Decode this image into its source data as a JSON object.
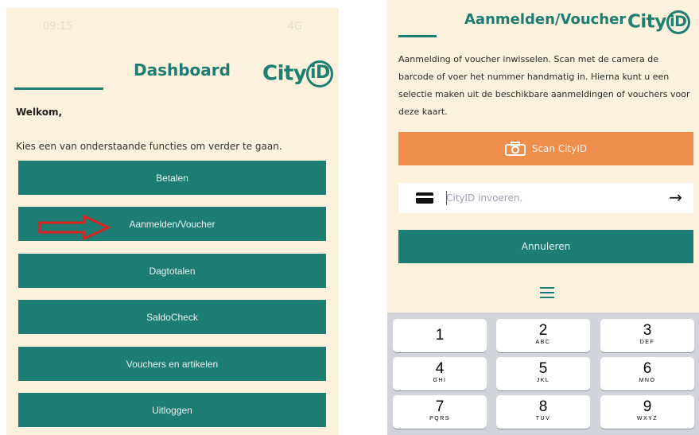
{
  "left": {
    "status": {
      "time": "09:15",
      "network": "4G"
    },
    "title": "Dashboard",
    "logo": {
      "text_a": "City",
      "text_b": "iD"
    },
    "welcome": "Welkom,",
    "instruction": "Kies een van onderstaande functies om verder te gaan.",
    "menu": [
      {
        "label": "Betalen"
      },
      {
        "label": "Aanmelden/Voucher"
      },
      {
        "label": "Dagtotalen"
      },
      {
        "label": "SaldoCheck"
      },
      {
        "label": "Vouchers en artikelen"
      },
      {
        "label": "Uitloggen"
      }
    ],
    "annotation": {
      "icon": "red-arrow-icon",
      "color": "#e02020",
      "points_to": "Aanmelden/Voucher"
    }
  },
  "right": {
    "title": "Aanmelden/Voucher",
    "logo": {
      "text_a": "City",
      "text_b": "iD"
    },
    "description": "Aanmelding of voucher inwisselen. Scan met de camera de barcode of voer het nummer handmatig in. Hierna kunt u een selectie maken uit de beschikbare aanmeldingen of vouchers voor deze kaart.",
    "scan_button": {
      "label": "Scan CityID",
      "icon": "camera-icon"
    },
    "cityid_input": {
      "placeholder": "CityID invoeren.",
      "value": "",
      "icon": "card-icon",
      "submit_icon": "arrow-right-icon"
    },
    "cancel_button": {
      "label": "Annuleren"
    },
    "menu_icon": "hamburger-icon",
    "keypad": [
      {
        "digit": "1",
        "letters": ""
      },
      {
        "digit": "2",
        "letters": "ABC"
      },
      {
        "digit": "3",
        "letters": "DEF"
      },
      {
        "digit": "4",
        "letters": "GHI"
      },
      {
        "digit": "5",
        "letters": "JKL"
      },
      {
        "digit": "6",
        "letters": "MNO"
      },
      {
        "digit": "7",
        "letters": "PQRS"
      },
      {
        "digit": "8",
        "letters": "TUV"
      },
      {
        "digit": "9",
        "letters": "WXYZ"
      }
    ]
  },
  "colors": {
    "brand_teal": "#1e7d72",
    "scan_orange": "#ef8d4c",
    "background_cream": "#fcf1dc"
  }
}
